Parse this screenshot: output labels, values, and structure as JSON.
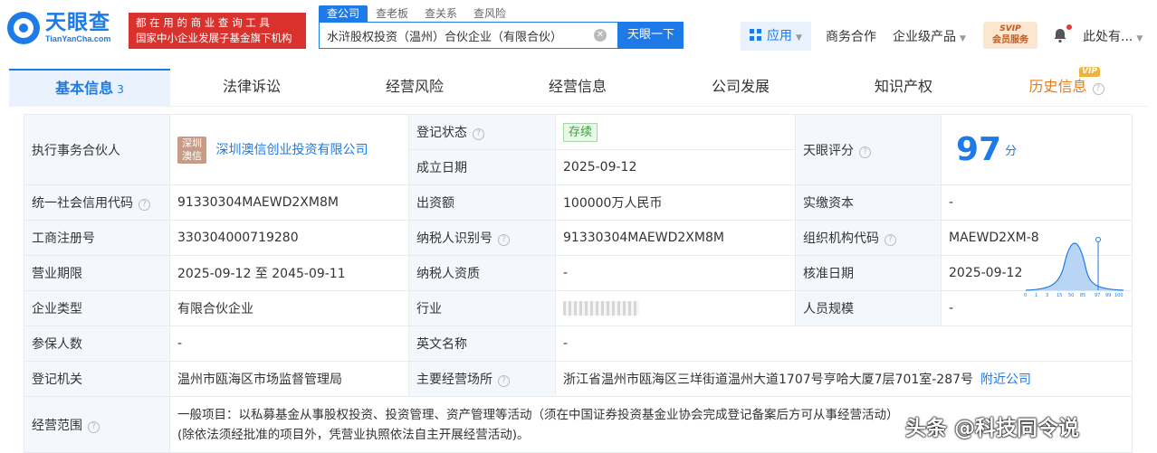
{
  "header": {
    "logo_cn": "天眼查",
    "logo_en": "TianYanCha.com",
    "slogan_line1": "都 在 用 的 商 业 查 询 工 具",
    "slogan_line2": "国家中小企业发展子基金旗下机构",
    "search_tabs": [
      "查公司",
      "查老板",
      "查关系",
      "查风险"
    ],
    "search_value": "水浒股权投资（温州）合伙企业（有限合伙）",
    "search_button": "天眼一下",
    "nav": {
      "app": "应用",
      "business": "商务合作",
      "enterprise": "企业级产品",
      "vip_top": "SVIP",
      "vip_bottom": "会员服务",
      "user": "此处有..."
    }
  },
  "tabs": {
    "basic": "基本信息",
    "basic_count": "3",
    "legal": "法律诉讼",
    "risk": "经营风险",
    "ops": "经营信息",
    "dev": "公司发展",
    "ip": "知识产权",
    "history": "历史信息",
    "history_tag": "VIP"
  },
  "info": {
    "partner_label": "执行事务合伙人",
    "partner_logo": "深圳澳信",
    "partner_name": "深圳澳信创业投资有限公司",
    "reg_status_label": "登记状态",
    "reg_status": "存续",
    "found_date_label": "成立日期",
    "found_date": "2025-09-12",
    "score_label": "天眼评分",
    "score": "97",
    "score_unit": "分",
    "score_axis": [
      "0",
      "1",
      "3",
      "15",
      "50",
      "85",
      "97",
      "99",
      "100"
    ],
    "credit_code_label": "统一社会信用代码",
    "credit_code": "91330304MAEWD2XM8M",
    "capital_label": "出资额",
    "capital": "100000万人民币",
    "paid_capital_label": "实缴资本",
    "paid_capital": "-",
    "reg_no_label": "工商注册号",
    "reg_no": "330304000719280",
    "taxpayer_id_label": "纳税人识别号",
    "taxpayer_id": "91330304MAEWD2XM8M",
    "org_code_label": "组织机构代码",
    "org_code": "MAEWD2XM-8",
    "term_label": "营业期限",
    "term": "2025-09-12 至 2045-09-11",
    "taxpayer_qual_label": "纳税人资质",
    "taxpayer_qual": "-",
    "approve_date_label": "核准日期",
    "approve_date": "2025-09-12",
    "type_label": "企业类型",
    "type": "有限合伙企业",
    "industry_label": "行业",
    "staff_label": "人员规模",
    "staff": "-",
    "insured_label": "参保人数",
    "insured": "-",
    "en_name_label": "英文名称",
    "en_name": "-",
    "authority_label": "登记机关",
    "authority": "温州市瓯海区市场监督管理局",
    "address_label": "主要经营场所",
    "address": "浙江省温州市瓯海区三垟街道温州大道1707号亨哈大厦7层701室-287号",
    "nearby": "附近公司",
    "scope_label": "经营范围",
    "scope_line1": "一般项目：以私募基金从事股权投资、投资管理、资产管理等活动（须在中国证券投资基金业协会完成登记备案后方可从事经营活动）",
    "scope_line2": "(除依法须经批准的项目外，凭营业执照依法自主开展经营活动)。"
  },
  "watermark": "头条 @科技同令说",
  "colors": {
    "brand_blue": "#1d7ae6",
    "slogan_red": "#d9322d",
    "history_orange": "#e57c1a",
    "key_cell_bg": "#f4f8fd",
    "status_green": "#3aa33a"
  }
}
